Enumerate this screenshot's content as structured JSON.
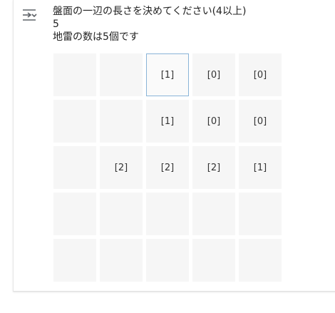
{
  "output": {
    "icon": "output-toggle-icon",
    "lines": [
      "盤面の一辺の長さを決めてください(4以上)",
      "5",
      "地雷の数は5個です"
    ]
  },
  "board": {
    "size": 5,
    "focused_cell": [
      0,
      2
    ],
    "rows": [
      [
        "",
        "",
        "[1]",
        "[0]",
        "[0]"
      ],
      [
        "",
        "",
        "[1]",
        "[0]",
        "[0]"
      ],
      [
        "",
        "[2]",
        "[2]",
        "[2]",
        "[1]"
      ],
      [
        "",
        "",
        "",
        "",
        ""
      ],
      [
        "",
        "",
        "",
        "",
        ""
      ]
    ],
    "colors": {
      "cell_background": "#f6f6f6",
      "focus_border": "#8ab4d8",
      "text": "#333333"
    }
  }
}
